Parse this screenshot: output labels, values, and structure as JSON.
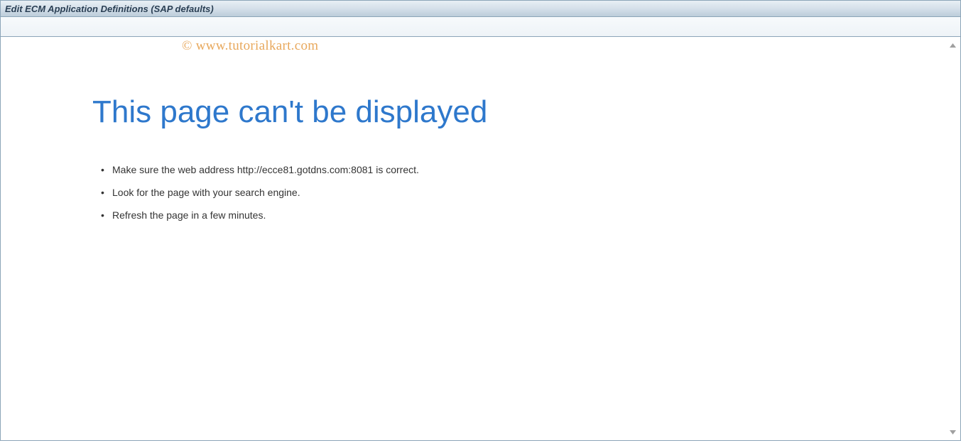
{
  "window": {
    "title": "Edit ECM Application Definitions (SAP defaults)"
  },
  "watermark": {
    "text": "© www.tutorialkart.com"
  },
  "error": {
    "heading": "This page can't be displayed",
    "items": [
      "Make sure the web address http://ecce81.gotdns.com:8081 is correct.",
      "Look for the page with your search engine.",
      "Refresh the page in a few minutes."
    ]
  }
}
